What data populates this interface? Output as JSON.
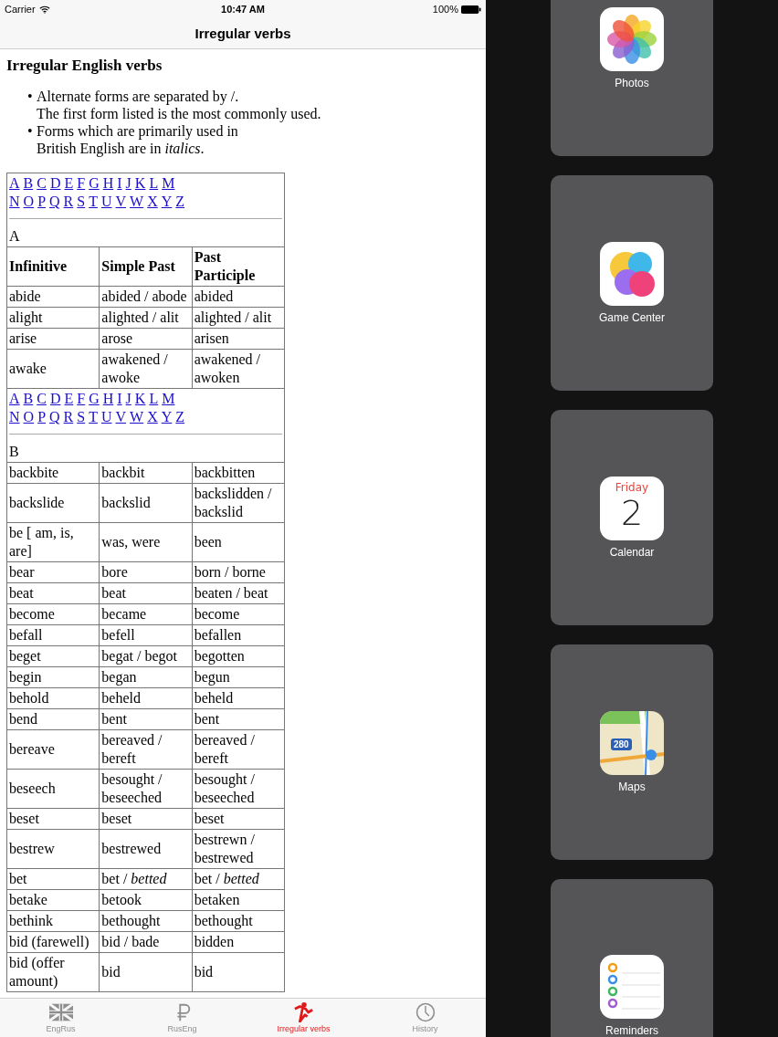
{
  "status_bar": {
    "carrier": "Carrier",
    "time": "10:47 AM",
    "battery": "100%"
  },
  "nav": {
    "title": "Irregular verbs"
  },
  "article": {
    "heading": "Irregular English verbs",
    "bullets": [
      {
        "marker": "•",
        "lines": [
          "Alternate forms are separated by /.",
          "The first form listed is the most commonly used."
        ]
      },
      {
        "marker": "•",
        "lines": [
          "Forms which are primarily used in",
          "British English are in *italics*."
        ]
      }
    ]
  },
  "table": {
    "sections": [
      {
        "alphabet": [
          [
            "A",
            "B",
            "C",
            "D",
            "E",
            "F",
            "G",
            "H",
            "I",
            "J",
            "K",
            "L",
            "M"
          ],
          [
            "N",
            "O",
            "P",
            "Q",
            "R",
            "S",
            "T",
            "U",
            "V",
            "W",
            "X",
            "Y",
            "Z"
          ]
        ],
        "letter": "A",
        "columns": [
          "Infinitive",
          "Simple Past",
          "Past Participle"
        ],
        "rows": [
          [
            "abide",
            "abided / abode",
            "abided"
          ],
          [
            "alight",
            "alighted / alit",
            "alighted / alit"
          ],
          [
            "arise",
            "arose",
            "arisen"
          ],
          [
            "awake",
            "awakened / awoke",
            "awakened / awoken"
          ]
        ]
      },
      {
        "alphabet": [
          [
            "A",
            "B",
            "C",
            "D",
            "E",
            "F",
            "G",
            "H",
            "I",
            "J",
            "K",
            "L",
            "M"
          ],
          [
            "N",
            "O",
            "P",
            "Q",
            "R",
            "S",
            "T",
            "U",
            "V",
            "W",
            "X",
            "Y",
            "Z"
          ]
        ],
        "letter": "B",
        "rows": [
          [
            "backbite",
            "backbit",
            "backbitten"
          ],
          [
            "backslide",
            "backslid",
            "backslidden / backslid"
          ],
          [
            "be [ am, is, are]",
            "was, were",
            "been"
          ],
          [
            "bear",
            "bore",
            "born / borne"
          ],
          [
            "beat",
            "beat",
            "beaten / beat"
          ],
          [
            "become",
            "became",
            "become"
          ],
          [
            "befall",
            "befell",
            "befallen"
          ],
          [
            "beget",
            "begat / begot",
            "begotten"
          ],
          [
            "begin",
            "began",
            "begun"
          ],
          [
            "behold",
            "beheld",
            "beheld"
          ],
          [
            "bend",
            "bent",
            "bent"
          ],
          [
            "bereave",
            "bereaved / bereft",
            "bereaved / bereft"
          ],
          [
            "beseech",
            "besought / beseeched",
            "besought / beseeched"
          ],
          [
            "beset",
            "beset",
            "beset"
          ],
          [
            "bestrew",
            "bestrewed",
            "bestrewn / bestrewed"
          ],
          [
            "bet",
            "bet / *betted*",
            "bet / *betted*"
          ],
          [
            "betake",
            "betook",
            "betaken"
          ],
          [
            "bethink",
            "bethought",
            "bethought"
          ],
          [
            "bid (farewell)",
            "bid / bade",
            "bidden"
          ],
          [
            "bid (offer amount)",
            "bid",
            "bid"
          ]
        ]
      }
    ]
  },
  "tab_bar": [
    {
      "kind": "flag",
      "label": "EngRus",
      "selected": false
    },
    {
      "kind": "ruble",
      "label": "RusEng",
      "selected": false
    },
    {
      "kind": "runner",
      "label": "Irregular verbs",
      "selected": true
    },
    {
      "kind": "clock",
      "label": "History",
      "selected": false
    }
  ],
  "app_switcher": [
    {
      "kind": "photos",
      "label": "Photos"
    },
    {
      "kind": "gamecenter",
      "label": "Game Center"
    },
    {
      "kind": "calendar",
      "label": "Calendar",
      "weekday": "Friday",
      "day": "2"
    },
    {
      "kind": "maps",
      "label": "Maps",
      "shield": "280"
    },
    {
      "kind": "reminders",
      "label": "Reminders"
    }
  ]
}
